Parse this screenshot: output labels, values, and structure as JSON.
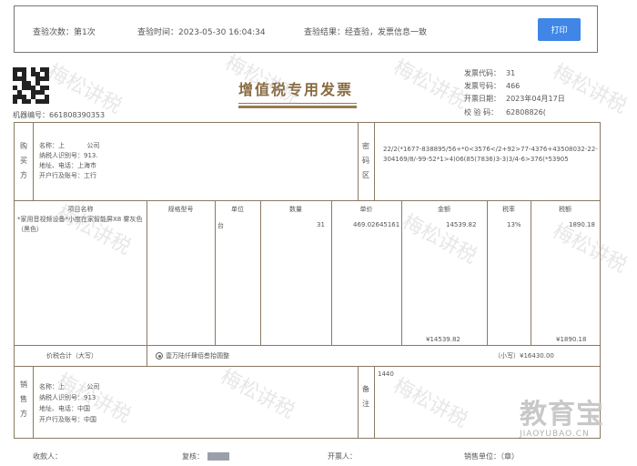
{
  "check_bar": {
    "count_label": "查验次数：",
    "count_value": "第1次",
    "time_label": "查验时间：",
    "time_value": "2023-05-30 16:04:34",
    "result_label": "查验结果：",
    "result_value": "经查验，发票信息一致",
    "print_label": "打印"
  },
  "invoice": {
    "title": "增值税专用发票",
    "machine_label": "机器编号：",
    "machine_value": "661808390353",
    "code_label": "发票代码：",
    "code_value": "31",
    "number_label": "发票号码：",
    "number_value": "466",
    "date_label": "开票日期：",
    "date_value": "2023年04月17日",
    "check_code_label": "校 验 码：",
    "check_code_value": "62808826(",
    "buyer_side_label": "购买方",
    "buyer_name_label": "名称：",
    "buyer_name_value": "上",
    "buyer_name_suffix": "公司",
    "buyer_taxid_label": "纳税人识别号：",
    "buyer_taxid_value": "913.",
    "buyer_address_label": "地址、电话：",
    "buyer_address_value": "上海市",
    "buyer_bank_label": "开户行及账号：",
    "buyer_bank_value": "工行",
    "password_area_label": "密码区",
    "cipher_text": "22/2(*1677-838895/56+*0<3576</2+92>77-4376+43508032-22-304169/8/-99-52*1>4)06(85(7836)3-3)3/4-6>376(*53905",
    "col_item": "项目名称",
    "col_spec": "规格型号",
    "col_unit": "单位",
    "col_qty": "数量",
    "col_price": "单价",
    "col_amount": "金额",
    "col_rate": "税率",
    "col_tax": "税额",
    "item_name": "*家用音视频设备*小度在家智能屏X8   雾灰色（黑色）",
    "item_unit": "台",
    "item_qty": "31",
    "item_price": "469.02645161",
    "item_amount": "14539.82",
    "item_rate": "13%",
    "item_tax": "1890.18",
    "sum_amount": "¥14539.82",
    "sum_tax": "¥1890.18",
    "total_label": "价税合计（大写）",
    "total_upper": "壹万陆仟肆佰叁拾圆整",
    "total_small_label": "（小写）",
    "total_small_value": "¥16430.00",
    "seller_side_label": "销售方",
    "seller_name_label": "名称：",
    "seller_name_value": "上",
    "seller_name_suffix": "公司",
    "seller_taxid_label": "纳税人识别号：",
    "seller_taxid_value": "913",
    "seller_address_label": "地址、电话：",
    "seller_address_value": "中国",
    "seller_bank_label": "开户行及账号：",
    "seller_bank_value": "中国",
    "remark_label": "备注",
    "remark_value": "1440"
  },
  "footer": {
    "payee_label": "收款人：",
    "reviewer_label": "复核：",
    "drawer_label": "开票人：",
    "seller_label": "销售单位：",
    "seller_value": "（章）"
  },
  "watermark_text": "梅松讲税",
  "logo": {
    "main": "教育宝",
    "url": "JIAOYUBAO.CN"
  },
  "colors": {
    "accent": "#3f86e6",
    "invoice_line": "#8a7a62",
    "title": "#8a6a40"
  }
}
